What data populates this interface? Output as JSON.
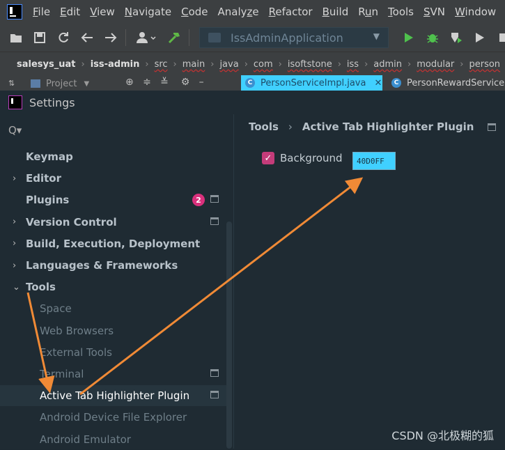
{
  "menubar": {
    "items": [
      {
        "label": "File",
        "mnemonic": "F"
      },
      {
        "label": "Edit",
        "mnemonic": "E"
      },
      {
        "label": "View",
        "mnemonic": "V"
      },
      {
        "label": "Navigate",
        "mnemonic": "N"
      },
      {
        "label": "Code",
        "mnemonic": "C"
      },
      {
        "label": "Analyze",
        "mnemonic": "z"
      },
      {
        "label": "Refactor",
        "mnemonic": "R"
      },
      {
        "label": "Build",
        "mnemonic": "B"
      },
      {
        "label": "Run",
        "mnemonic": "u"
      },
      {
        "label": "Tools",
        "mnemonic": "T"
      },
      {
        "label": "SVN",
        "mnemonic": "S"
      },
      {
        "label": "Window",
        "mnemonic": "W"
      }
    ]
  },
  "toolbar": {
    "run_config": "IssAdminApplication",
    "icons": [
      "open-folder-icon",
      "save-icon",
      "sync-icon",
      "back-icon",
      "forward-icon",
      "user-icon",
      "build-hammer-icon"
    ],
    "run_icons": [
      "run-icon",
      "debug-icon",
      "coverage-icon",
      "profile-icon",
      "stop-icon"
    ]
  },
  "breadcrumb": {
    "items": [
      {
        "label": "salesys_uat",
        "bold": true,
        "wavy": false
      },
      {
        "label": "iss-admin",
        "bold": true,
        "wavy": false
      },
      {
        "label": "src",
        "bold": false,
        "wavy": true
      },
      {
        "label": "main",
        "bold": false,
        "wavy": true
      },
      {
        "label": "java",
        "bold": false,
        "wavy": true
      },
      {
        "label": "com",
        "bold": false,
        "wavy": true
      },
      {
        "label": "isoftstone",
        "bold": false,
        "wavy": true
      },
      {
        "label": "iss",
        "bold": false,
        "wavy": true
      },
      {
        "label": "admin",
        "bold": false,
        "wavy": true
      },
      {
        "label": "modular",
        "bold": false,
        "wavy": true
      },
      {
        "label": "person",
        "bold": false,
        "wavy": true
      }
    ]
  },
  "tabs": {
    "project_label": "Project",
    "active_file": "PersonServiceImpl.java",
    "other_file": "PersonRewardServiceI",
    "active_color": "#40D0FF"
  },
  "dialog": {
    "title": "Settings",
    "search_placeholder": "Q▾",
    "sidebar": [
      {
        "label": "Keymap",
        "arrow": "",
        "child": false,
        "badge": "",
        "icon": false,
        "selected": false
      },
      {
        "label": "Editor",
        "arrow": "›",
        "child": false,
        "badge": "",
        "icon": false,
        "selected": false
      },
      {
        "label": "Plugins",
        "arrow": "",
        "child": false,
        "badge": "2",
        "icon": true,
        "selected": false
      },
      {
        "label": "Version Control",
        "arrow": "›",
        "child": false,
        "badge": "",
        "icon": true,
        "selected": false
      },
      {
        "label": "Build, Execution, Deployment",
        "arrow": "›",
        "child": false,
        "badge": "",
        "icon": false,
        "selected": false
      },
      {
        "label": "Languages & Frameworks",
        "arrow": "›",
        "child": false,
        "badge": "",
        "icon": false,
        "selected": false
      },
      {
        "label": "Tools",
        "arrow": "⌄",
        "child": false,
        "badge": "",
        "icon": false,
        "selected": false
      },
      {
        "label": "Space",
        "arrow": "",
        "child": true,
        "badge": "",
        "icon": false,
        "selected": false
      },
      {
        "label": "Web Browsers",
        "arrow": "",
        "child": true,
        "badge": "",
        "icon": false,
        "selected": false
      },
      {
        "label": "External Tools",
        "arrow": "",
        "child": true,
        "badge": "",
        "icon": false,
        "selected": false
      },
      {
        "label": "Terminal",
        "arrow": "",
        "child": true,
        "badge": "",
        "icon": true,
        "selected": false
      },
      {
        "label": "Active Tab Highlighter Plugin",
        "arrow": "",
        "child": true,
        "badge": "",
        "icon": true,
        "selected": true
      },
      {
        "label": "Android Device File Explorer",
        "arrow": "",
        "child": true,
        "badge": "",
        "icon": false,
        "selected": false
      },
      {
        "label": "Android Emulator",
        "arrow": "",
        "child": true,
        "badge": "",
        "icon": false,
        "selected": false
      }
    ],
    "content": {
      "breadcrumb_parent": "Tools",
      "breadcrumb_sep": "›",
      "breadcrumb_current": "Active Tab Highlighter Plugin",
      "background_label": "Background",
      "background_checked": true,
      "background_value": "40D0FF"
    }
  },
  "colors": {
    "accent": "#40D0FF",
    "checkbox": "#C43C7A",
    "badge": "#D9307C",
    "annotation_arrow": "#F08A36"
  },
  "watermark": "CSDN @北极糊的狐"
}
